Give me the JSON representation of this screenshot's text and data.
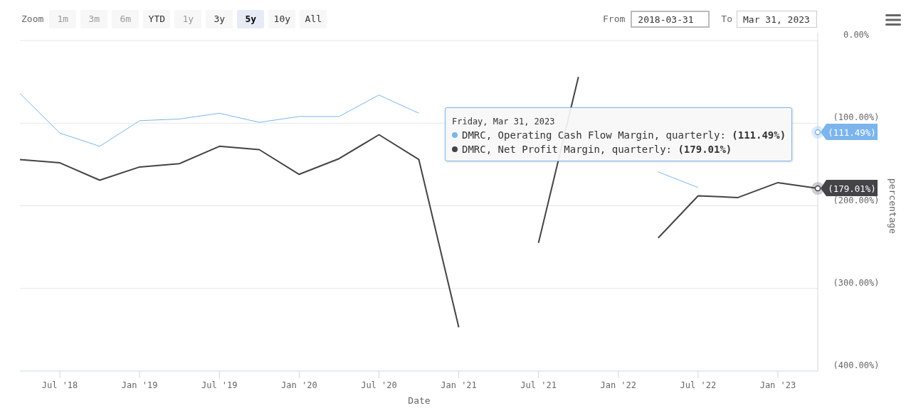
{
  "zoom": {
    "label": "Zoom",
    "buttons": [
      {
        "label": "1m",
        "disabled": true,
        "selected": false
      },
      {
        "label": "3m",
        "disabled": true,
        "selected": false
      },
      {
        "label": "6m",
        "disabled": true,
        "selected": false
      },
      {
        "label": "YTD",
        "disabled": false,
        "selected": false
      },
      {
        "label": "1y",
        "disabled": true,
        "selected": false
      },
      {
        "label": "3y",
        "disabled": false,
        "selected": false
      },
      {
        "label": "5y",
        "disabled": false,
        "selected": true
      },
      {
        "label": "10y",
        "disabled": false,
        "selected": false
      },
      {
        "label": "All",
        "disabled": false,
        "selected": false
      }
    ]
  },
  "range": {
    "from_label": "From",
    "from_value": "2018-03-31",
    "to_label": "To",
    "to_value": "Mar 31, 2023"
  },
  "chart": {
    "chart_data": {
      "type": "line",
      "xlabel": "Date",
      "ylabel": "percentage",
      "categories": [
        null,
        "Jul '18",
        null,
        "Jan '19",
        null,
        "Jul '19",
        null,
        "Jan '20",
        null,
        "Jul '20",
        null,
        "Jan '21",
        null,
        "Jul '21",
        null,
        "Jan '22",
        null,
        "Jul '22",
        null,
        "Jan '23",
        null
      ],
      "ylim": [
        -400,
        0
      ],
      "grid": true,
      "yticks": [
        {
          "value": 0,
          "label": "0.00%"
        },
        {
          "value": -100,
          "label": "(100.00%)"
        },
        {
          "value": -200,
          "label": "(200.00%)"
        },
        {
          "value": -300,
          "label": "(300.00%)"
        },
        {
          "value": -400,
          "label": "(400.00%)"
        }
      ],
      "series": [
        {
          "name": "DMRC, Operating Cash Flow Margin, quarterly",
          "color": "#7cb5ec",
          "values": [
            -64,
            -112,
            -128,
            -97,
            -95,
            -88,
            -99,
            -92,
            -92,
            -66,
            -88,
            null,
            null,
            null,
            null,
            null,
            -159,
            -178,
            null,
            null,
            -111
          ]
        },
        {
          "name": "DMRC, Net Profit Margin, quarterly",
          "color": "#434348",
          "values": [
            -144,
            -148,
            -169,
            -153,
            -149,
            -128,
            -132,
            -162,
            -143,
            -114,
            -144,
            -347,
            null,
            -245,
            -44,
            null,
            -239,
            -188,
            -190,
            -172,
            -179
          ]
        }
      ]
    }
  },
  "tooltip": {
    "date": "Friday, Mar 31, 2023",
    "separator": ": ",
    "items": [
      {
        "value": "(111.49%)",
        "color": "#7cb5ec"
      },
      {
        "value": "(179.01%)",
        "color": "#434348"
      }
    ]
  },
  "flags": [
    {
      "text": "(111.49%)",
      "color": "#7cb5ec"
    },
    {
      "text": "(179.01%)",
      "color": "#434348"
    }
  ]
}
